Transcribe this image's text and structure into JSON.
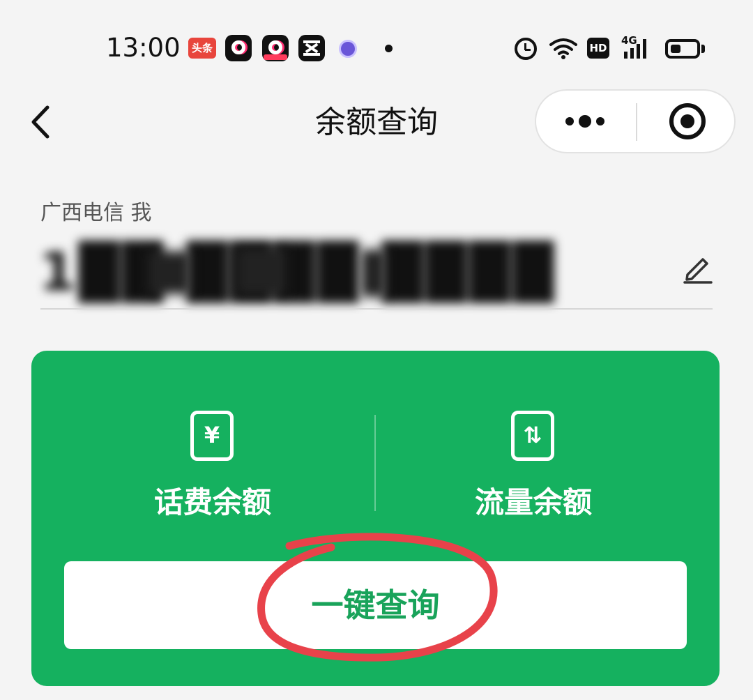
{
  "status_bar": {
    "time": "13:00",
    "apps": [
      {
        "name": "toutiao-app-icon",
        "label": "头条"
      },
      {
        "name": "douyin-app-icon"
      },
      {
        "name": "douyin-lite-app-icon"
      },
      {
        "name": "capcut-app-icon"
      },
      {
        "name": "purple-app-icon"
      }
    ],
    "hd_label": "HD",
    "network_label": "4G",
    "battery_level": 0.42
  },
  "nav": {
    "title": "余额查询",
    "back_icon": "chevron-left-icon",
    "more_icon": "more-dots-icon",
    "close_icon": "target-close-icon"
  },
  "account": {
    "carrier": "广西电信 我",
    "phone_number": "1██ ████ ████",
    "edit_icon": "pencil-icon"
  },
  "card": {
    "background": "#15b15f",
    "options": [
      {
        "name": "bill-balance",
        "icon_glyph": "¥",
        "label": "话费余额"
      },
      {
        "name": "data-balance",
        "icon_glyph": "⇅",
        "label": "流量余额"
      }
    ],
    "query_button": "一键查询",
    "query_button_color": "#19a35a",
    "annotation_color": "#e8424a"
  }
}
